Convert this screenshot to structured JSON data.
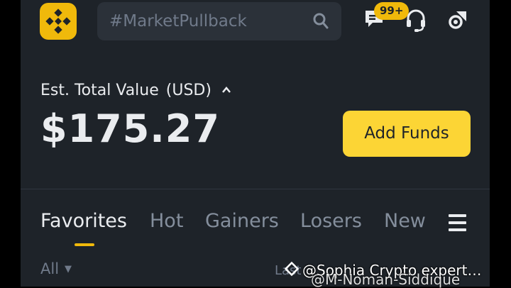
{
  "header": {
    "search_placeholder": "#MarketPullback",
    "notification_count": "99+",
    "icons": [
      "binance-logo-icon",
      "search-icon",
      "chat-icon",
      "support-headset-icon",
      "scan-icon"
    ]
  },
  "balance": {
    "label": "Est. Total Value",
    "currency": "(USD)",
    "value": "$175.27",
    "add_funds_label": "Add Funds"
  },
  "market_tabs": {
    "items": [
      {
        "label": "Favorites",
        "active": true
      },
      {
        "label": "Hot",
        "active": false
      },
      {
        "label": "Gainers",
        "active": false
      },
      {
        "label": "Losers",
        "active": false
      },
      {
        "label": "New",
        "active": false
      }
    ]
  },
  "list_header": {
    "filter_label": "All",
    "column_label": "Last"
  },
  "watermarks": {
    "line1": "@Sophia Crypto expert…",
    "line2": "@M-Noman-Siddique"
  },
  "colors": {
    "brand": "#f0b90b",
    "button": "#fcd535",
    "background": "#1e2329",
    "search_bg": "#2b3139"
  }
}
